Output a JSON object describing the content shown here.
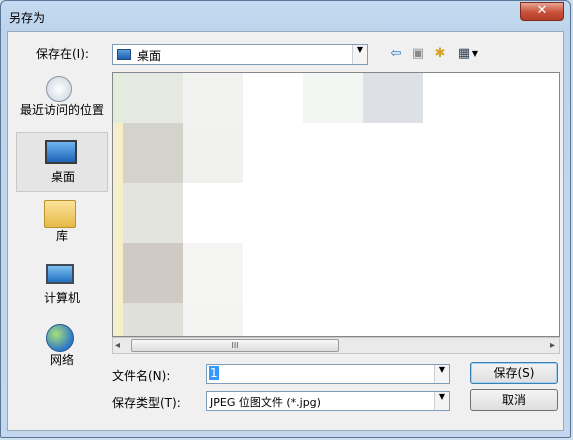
{
  "window": {
    "title": "另存为",
    "close_symbol": "✕"
  },
  "location": {
    "label": "保存在(I):",
    "value": "桌面"
  },
  "toolbar": {
    "back_icon": "⇦",
    "up_icon": "▣",
    "new_folder_icon": "✱",
    "views_icon": "▦"
  },
  "places": [
    {
      "label": "最近访问的位置",
      "icon": "recent-places-icon"
    },
    {
      "label": "桌面",
      "icon": "desktop-icon"
    },
    {
      "label": "库",
      "icon": "library-icon"
    },
    {
      "label": "计算机",
      "icon": "computer-icon"
    },
    {
      "label": "网络",
      "icon": "network-icon"
    }
  ],
  "scrollbar": {
    "left_arrow": "◂",
    "right_arrow": "▸",
    "grip": "III"
  },
  "filename": {
    "label": "文件名(N):",
    "value": "1"
  },
  "filetype": {
    "label": "保存类型(T):",
    "value": "JPEG 位图文件  (*.jpg)"
  },
  "buttons": {
    "save": "保存(S)",
    "cancel": "取消"
  },
  "colors": {
    "title_bar": "#bdd4ec",
    "close_button": "#c7503a",
    "list_bg": "#ffffff"
  }
}
